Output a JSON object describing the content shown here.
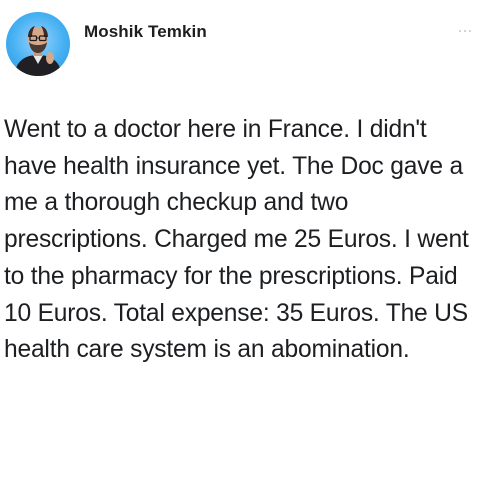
{
  "post": {
    "author": {
      "name": "Moshik Temkin",
      "avatar_icon": "profile-photo"
    },
    "body": "Went to a doctor here in France. I didn't have health insurance yet. The Doc gave a me a thorough checkup and two prescriptions. Charged me 25 Euros. I went to the pharmacy for the prescriptions. Paid 10 Euros. Total expense: 35 Euros. The US health care system is an abomination.",
    "more_icon": "more-options-icon"
  },
  "colors": {
    "avatar_background": "#45b0f2",
    "text": "#1c1e21"
  }
}
